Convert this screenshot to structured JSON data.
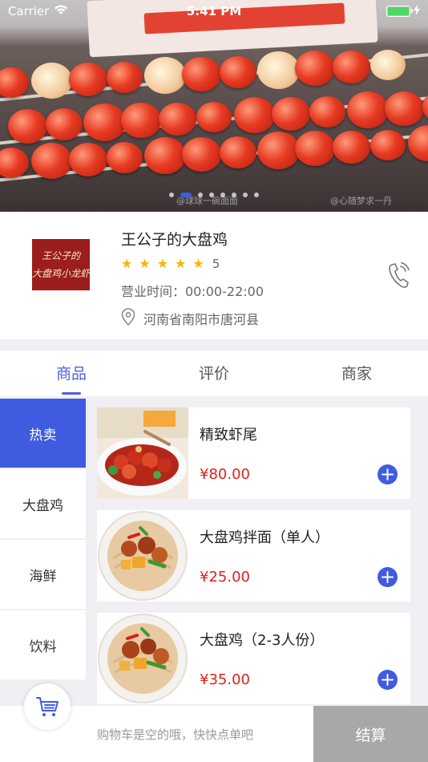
{
  "status_bar": {
    "carrier": "Carrier",
    "time": "5:41 PM",
    "battery_level": 1.0
  },
  "banner": {
    "page_count": 8,
    "active_page": 1,
    "watermarks": [
      "@球球一碗面面",
      "@心随梦求一丹"
    ]
  },
  "shop": {
    "logo_text_line1": "王公子的",
    "logo_text_line2": "大盘鸡小龙虾",
    "name": "王公子的大盘鸡",
    "rating": "5",
    "hours": "营业时间：00:00-22:00",
    "address": "河南省南阳市唐河县"
  },
  "tabs": [
    {
      "label": "商品",
      "active": true
    },
    {
      "label": "评价",
      "active": false
    },
    {
      "label": "商家",
      "active": false
    }
  ],
  "categories": [
    {
      "label": "热卖",
      "active": true
    },
    {
      "label": "大盘鸡",
      "active": false
    },
    {
      "label": "海鲜",
      "active": false
    },
    {
      "label": "饮料",
      "active": false
    }
  ],
  "products": [
    {
      "name": "精致虾尾",
      "price": "¥80.00"
    },
    {
      "name": "大盘鸡拌面（单人）",
      "price": "¥25.00"
    },
    {
      "name": "大盘鸡（2-3人份）",
      "price": "¥35.00"
    }
  ],
  "cart": {
    "empty_message": "购物车是空的哦，快快点单吧",
    "checkout_label": "结算"
  },
  "colors": {
    "accent": "#3f5be0",
    "price": "#e0201e",
    "star": "#f7b500",
    "checkout_disabled": "#a8a8a8"
  },
  "icons": {
    "wifi": "wifi-icon",
    "battery": "battery-icon",
    "charging": "charging-icon",
    "star": "star-icon",
    "location": "location-pin-icon",
    "phone": "phone-icon",
    "add": "plus-circle-icon",
    "cart": "cart-icon"
  }
}
